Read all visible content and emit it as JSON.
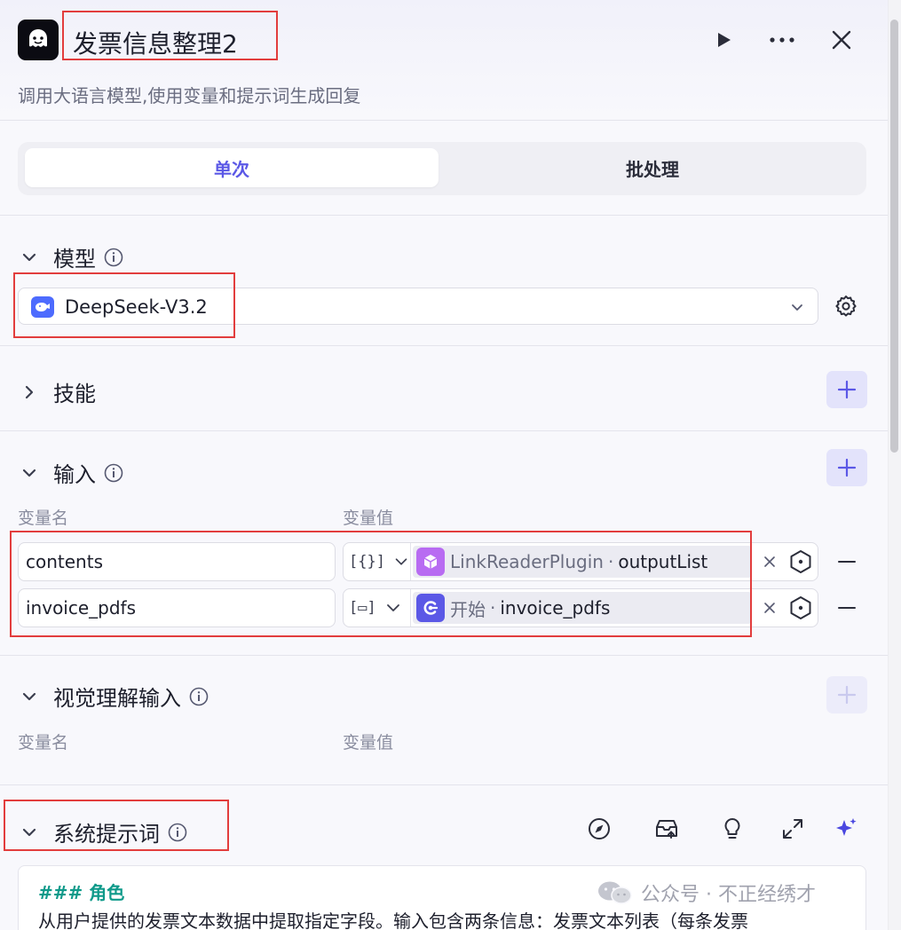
{
  "header": {
    "title": "发票信息整理2",
    "subtitle": "调用大语言模型,使用变量和提示词生成回复"
  },
  "tabs": [
    {
      "label": "单次",
      "active": true
    },
    {
      "label": "批处理",
      "active": false
    }
  ],
  "model_section": {
    "title": "模型",
    "selected_model": "DeepSeek-V3.2"
  },
  "skills_section": {
    "title": "技能"
  },
  "input_section": {
    "title": "输入",
    "col_name": "变量名",
    "col_value": "变量值",
    "rows": [
      {
        "name": "contents",
        "type_glyph": "[{}]",
        "source": "LinkReaderPlugin",
        "sep": "·",
        "field": "outputList"
      },
      {
        "name": "invoice_pdfs",
        "type_glyph": "[▭]",
        "source": "开始",
        "sep": "·",
        "field": "invoice_pdfs"
      }
    ]
  },
  "vision_section": {
    "title": "视觉理解输入",
    "col_name": "变量名",
    "col_value": "变量值"
  },
  "system_prompt": {
    "title": "系统提示词",
    "heading": "### 角色",
    "text": "从用户提供的发票文本数据中提取指定字段。输入包含两条信息：发票文本列表（每条发票"
  },
  "watermark": {
    "text": "公众号 · 不正经绣才"
  },
  "colors": {
    "accent": "#5b58e6",
    "red_highlight": "#e23d3d",
    "prompt_heading": "#0f9a8a"
  }
}
